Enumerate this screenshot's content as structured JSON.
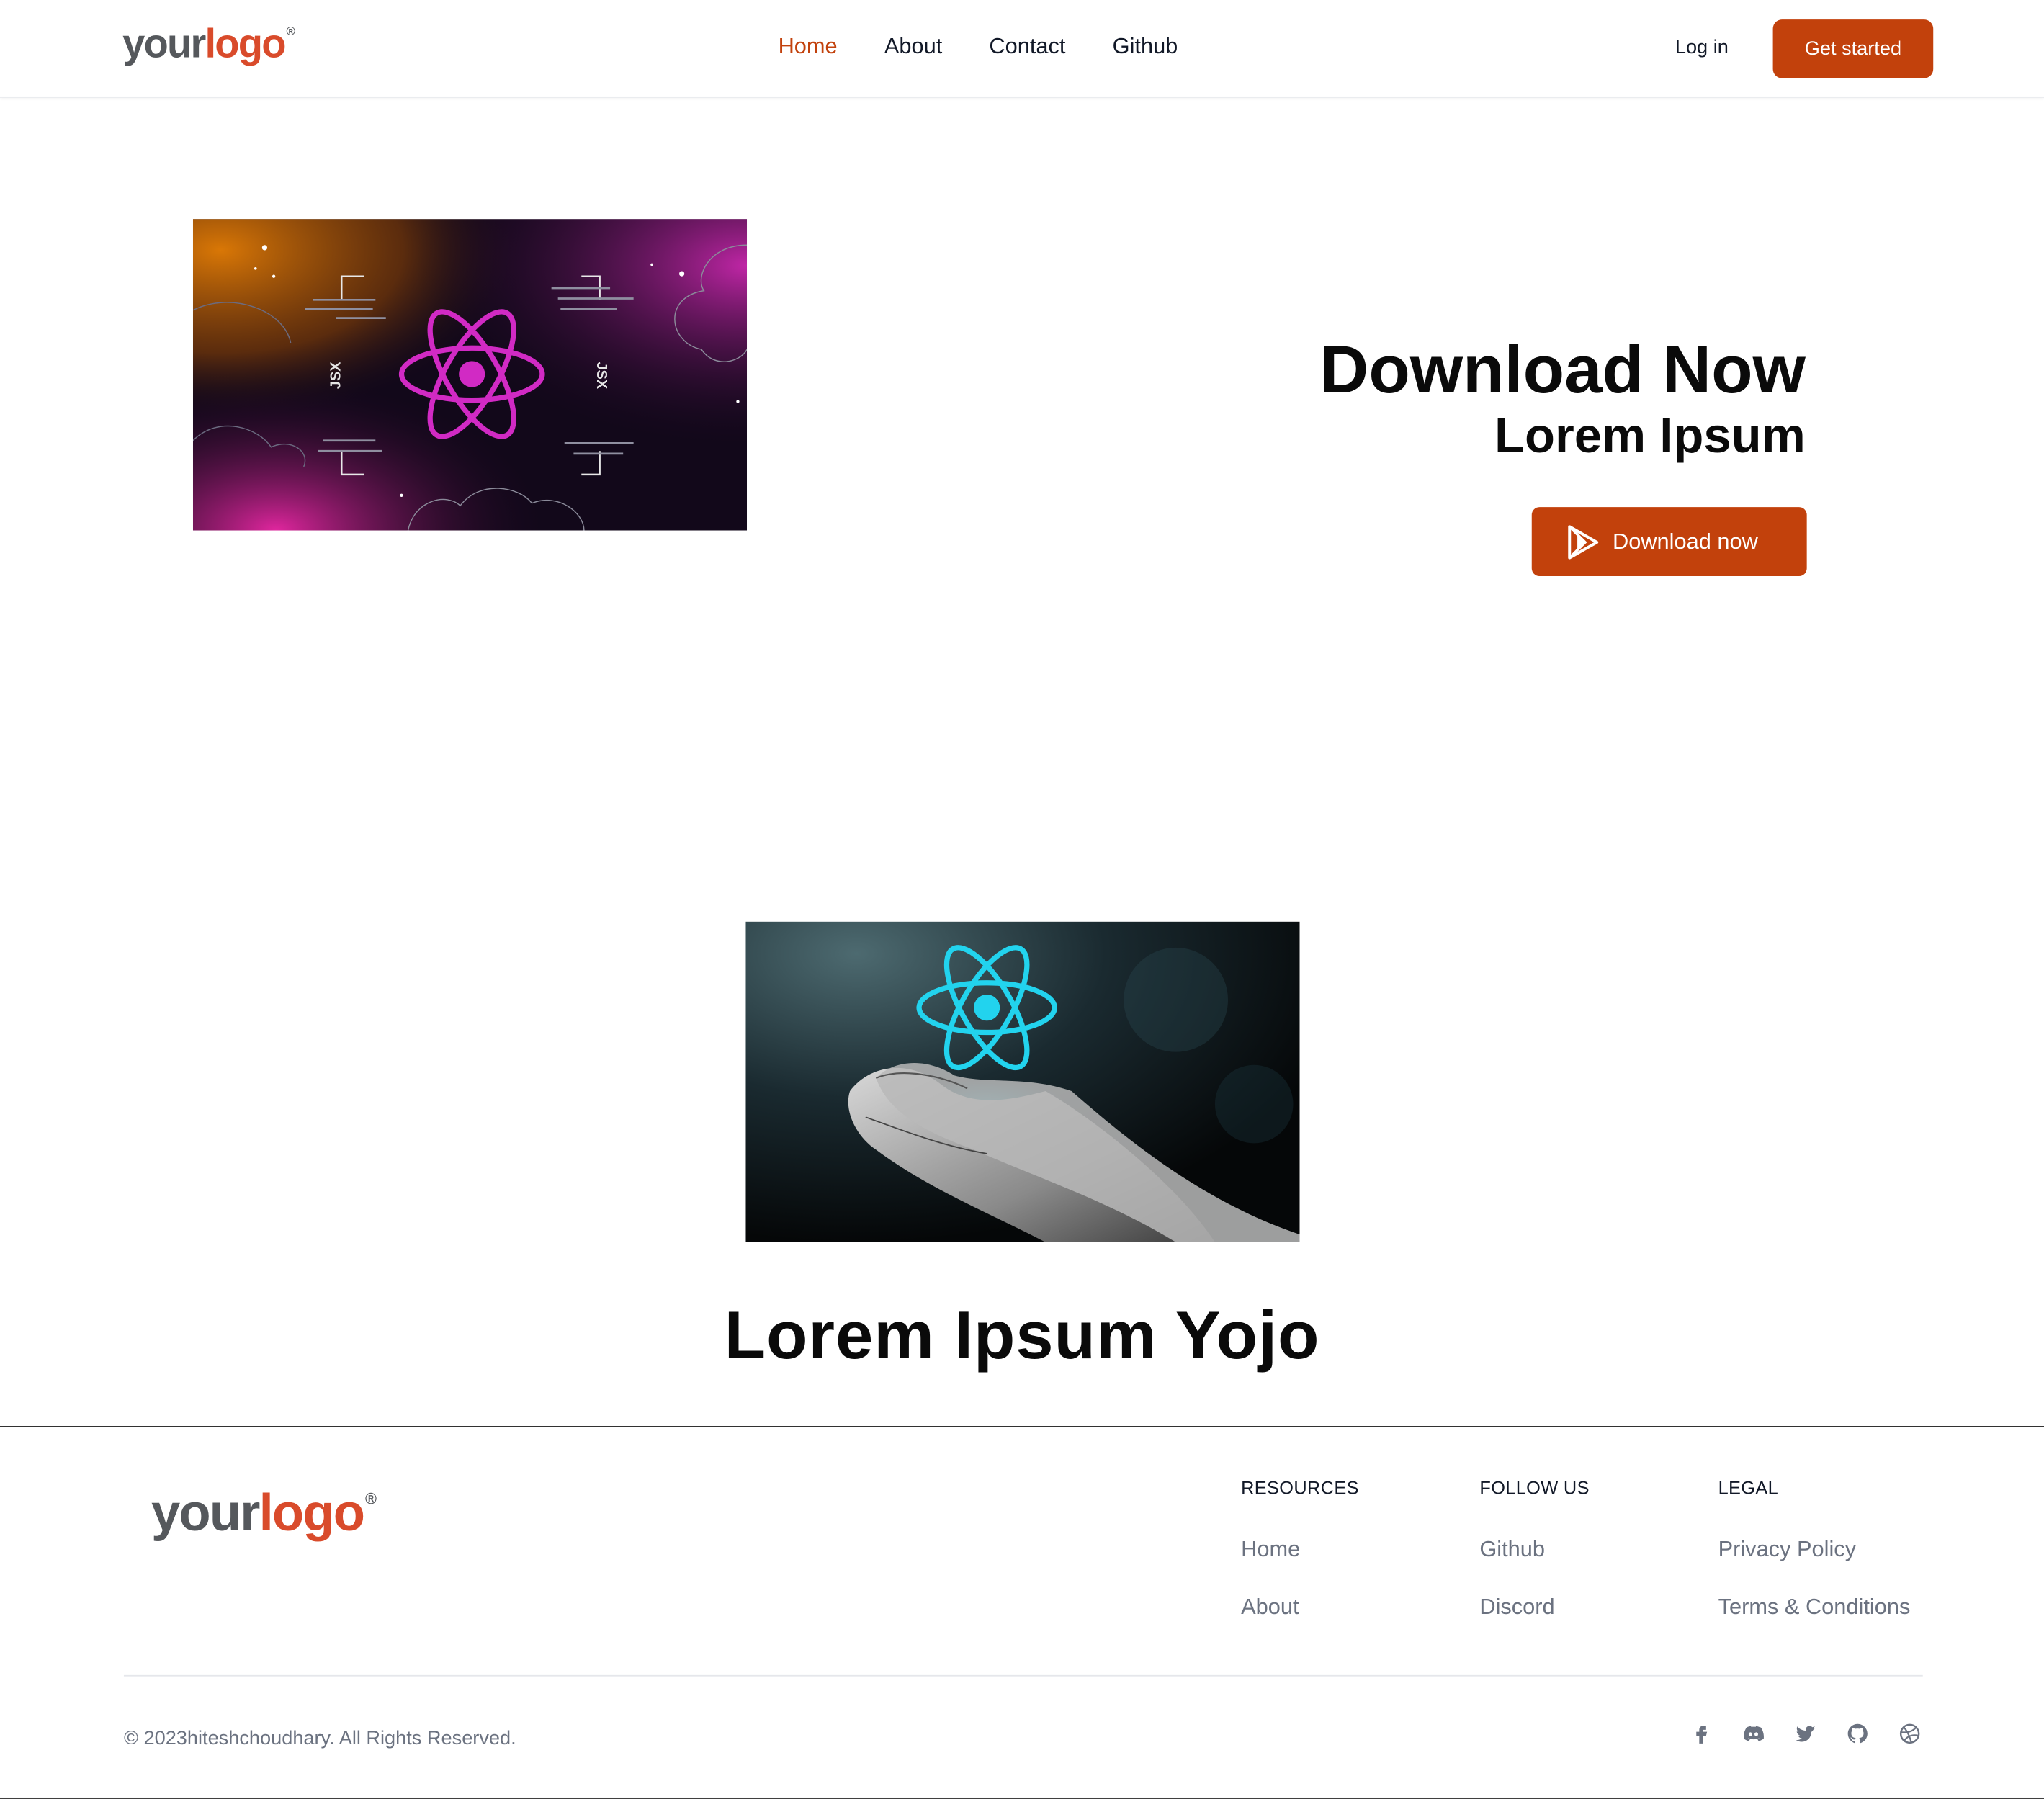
{
  "header": {
    "logo": {
      "your": "your",
      "logo": "logo",
      "mark": "®"
    },
    "nav": [
      {
        "label": "Home",
        "active": true
      },
      {
        "label": "About",
        "active": false
      },
      {
        "label": "Contact",
        "active": false
      },
      {
        "label": "Github",
        "active": false
      }
    ],
    "login_label": "Log in",
    "get_started_label": "Get started"
  },
  "hero": {
    "title": "Download Now",
    "subtitle": "Lorem Ipsum",
    "download_label": "Download now",
    "image_labels": {
      "left": "JSX",
      "right": "JSX"
    },
    "image_description": "react-logo-on-gradient-background"
  },
  "second": {
    "image_description": "react-logo-floating-above-hands",
    "title": "Lorem Ipsum Yojo"
  },
  "footer": {
    "logo": {
      "your": "your",
      "logo": "logo",
      "mark": "®"
    },
    "columns": [
      {
        "heading": "RESOURCES",
        "links": [
          "Home",
          "About"
        ]
      },
      {
        "heading": "FOLLOW US",
        "links": [
          "Github",
          "Discord"
        ]
      },
      {
        "heading": "LEGAL",
        "links": [
          "Privacy Policy",
          "Terms & Conditions"
        ]
      }
    ],
    "copyright": "© 2023hiteshchoudhary. All Rights Reserved.",
    "social_icons": [
      "facebook-icon",
      "discord-icon",
      "twitter-icon",
      "github-icon",
      "dribbble-icon"
    ]
  },
  "colors": {
    "accent": "#c2410c",
    "logo_gray": "#55585c",
    "logo_red": "#d94b2b",
    "muted_text": "#6b7280"
  }
}
